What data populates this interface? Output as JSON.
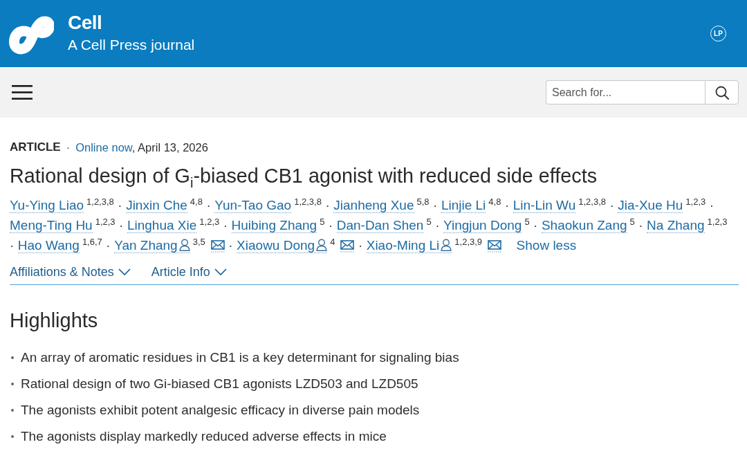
{
  "header": {
    "journal": "Cell",
    "tagline": "A Cell Press journal",
    "user_initials": "LP"
  },
  "toolbar": {
    "search": {
      "placeholder": "Search for..."
    }
  },
  "article": {
    "type": "ARTICLE",
    "separator": "·",
    "status": "Online now",
    "date": ", April 13, 2026",
    "title": "Rational design of G$_{i}$-biased CB1 agonist with reduced side effects",
    "authors": [
      {
        "name": "Yu-Ying Liao",
        "affiliations": "1,2,3,8",
        "corresponding": false,
        "email": false
      },
      {
        "lead": "·",
        "name": "Jinxin Che",
        "affiliations": "4,8",
        "corresponding": false,
        "email": false
      },
      {
        "lead": "·",
        "name": "Yun-Tao Gao",
        "affiliations": "1,2,3,8",
        "corresponding": false,
        "email": false
      },
      {
        "lead": "·",
        "name": "Jianheng Xue",
        "affiliations": "5,8",
        "corresponding": false,
        "email": false
      },
      {
        "lead": "·",
        "name": "Linjie Li",
        "affiliations": "4,8",
        "corresponding": false,
        "email": false
      },
      {
        "lead": "·",
        "name": "Lin-Lin Wu",
        "affiliations": "1,2,3,8",
        "corresponding": false,
        "email": false
      },
      {
        "lead": "·",
        "name": "Jia-Xue Hu",
        "affiliations": "1,2,3",
        "corresponding": false,
        "email": false
      },
      {
        "lead": "·",
        "name": "Meng-Ting Hu",
        "affiliations": "1,2,3",
        "corresponding": false,
        "email": false
      },
      {
        "lead": "·",
        "name": "Linghua Xie",
        "affiliations": "1,2,3",
        "corresponding": false,
        "email": false
      },
      {
        "lead": "·",
        "name": "Huibing Zhang",
        "affiliations": "5",
        "corresponding": false,
        "email": false
      },
      {
        "lead": "·",
        "name": "Dan-Dan Shen",
        "affiliations": "5",
        "corresponding": false,
        "email": false
      },
      {
        "lead": "·",
        "name": "Yingjun Dong",
        "affiliations": "5",
        "corresponding": false,
        "email": false
      },
      {
        "lead": "·",
        "name": "Shaokun Zang",
        "affiliations": "5",
        "corresponding": false,
        "email": false
      },
      {
        "lead": "·",
        "name": "Na Zhang",
        "affiliations": "1,2,3",
        "corresponding": false,
        "email": false
      },
      {
        "lead": "·",
        "name": "Hao Wang",
        "affiliations": "1,6,7",
        "corresponding": false,
        "email": false
      },
      {
        "lead": "·",
        "name": "Yan Zhang",
        "affiliations": "3,5",
        "corresponding": true,
        "email": true
      },
      {
        "lead": "·",
        "name": "Xiaowu Dong",
        "affiliations": "4",
        "corresponding": true,
        "email": true
      },
      {
        "lead": "·",
        "name": "Xiao-Ming Li",
        "affiliations": "1,2,3,9",
        "corresponding": true,
        "email": true
      }
    ],
    "show_less": "Show less",
    "sections": [
      {
        "label": "Affiliations & Notes",
        "expanded": false
      },
      {
        "label": "Article Info",
        "expanded": false
      }
    ]
  },
  "highlights": {
    "heading": "Highlights",
    "items": [
      "An array of aromatic residues in CB1 is a key determinant for signaling bias",
      "Rational design of two Gi-biased CB1 agonists LZD503 and LZD505",
      "The agonists exhibit potent analgesic efficacy in diverse pain models",
      "The agonists display markedly reduced adverse effects in mice"
    ]
  }
}
